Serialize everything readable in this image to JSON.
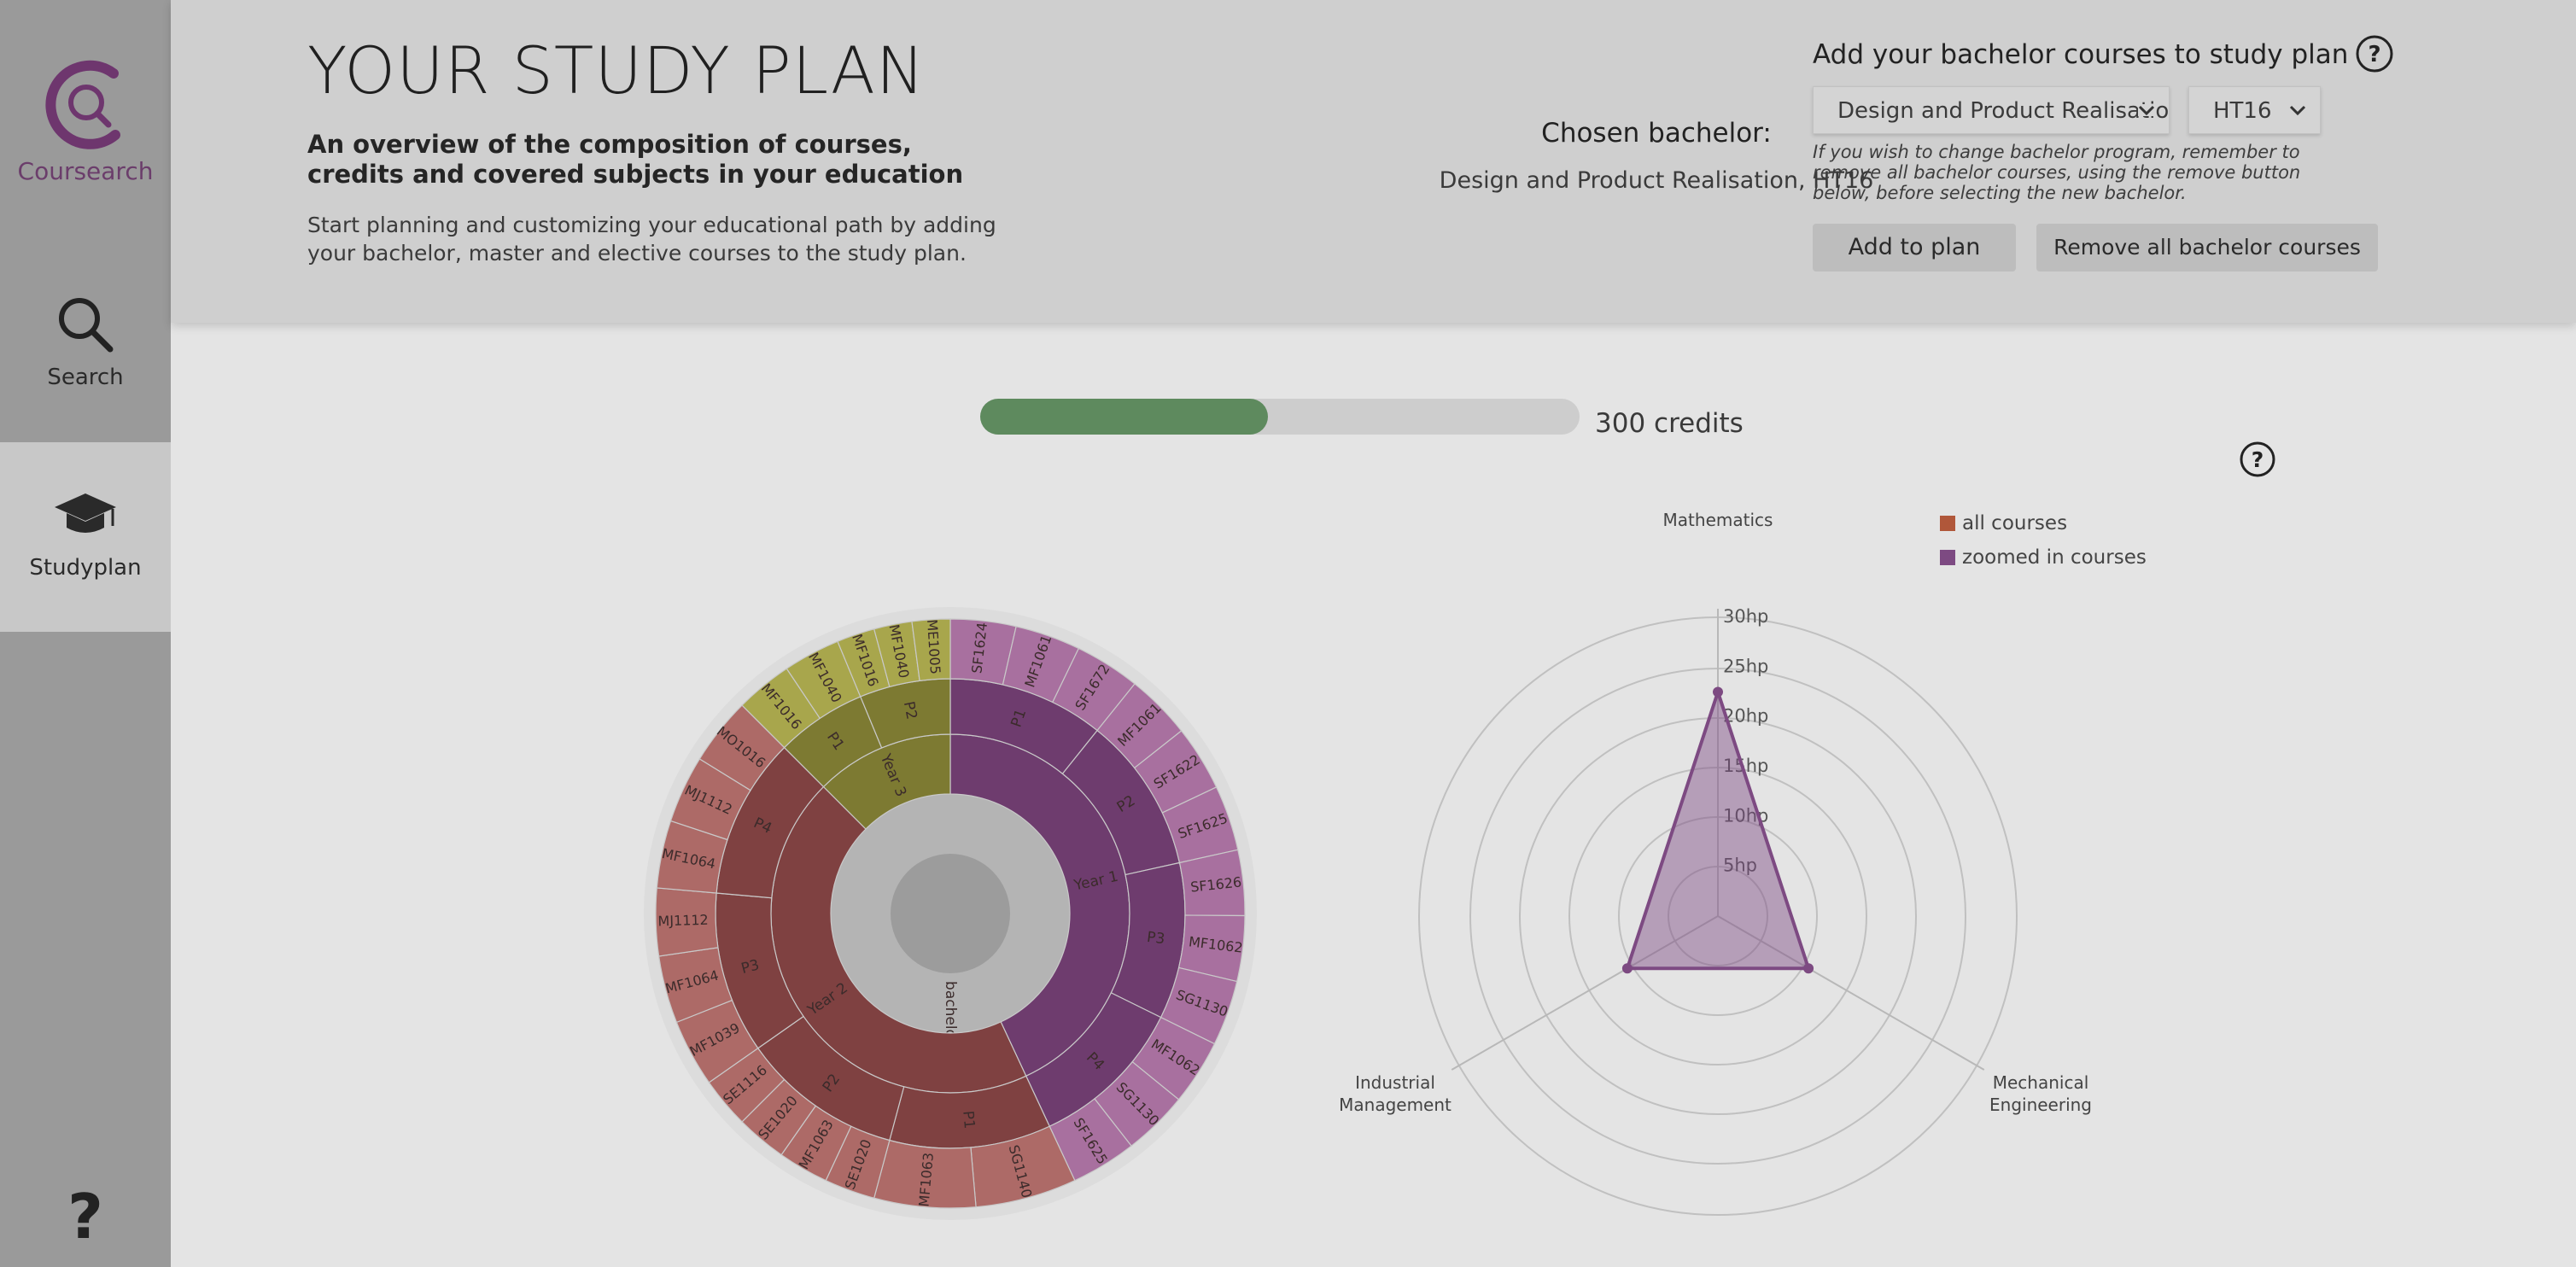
{
  "sidebar": {
    "logo_label": "Coursearch",
    "items": [
      {
        "label": "Search",
        "icon": "search-icon"
      },
      {
        "label": "Studyplan",
        "icon": "graduation-cap-icon",
        "active": true
      }
    ],
    "help_icon": "question-icon"
  },
  "header": {
    "title": "YOUR STUDY PLAN",
    "subtitle": "An overview of the composition of courses, credits and covered subjects in your education",
    "description": "Start planning and customizing your educational path by adding your bachelor, master and elective courses to the study plan.",
    "chosen_label": "Chosen bachelor:",
    "chosen_value": "Design and Product Realisation, HT16",
    "add_title": "Add your bachelor courses to study plan",
    "program_select": "Design and Product Realisation",
    "term_select": "HT16",
    "note": "If you wish to change bachelor program, remember to remove all bachelor courses, using the remove button below, before selecting the new bachelor.",
    "add_button": "Add to plan",
    "remove_button": "Remove all bachelor courses"
  },
  "progress": {
    "fraction": 0.48,
    "label": "300 credits",
    "color": "#5e8a5e"
  },
  "sunburst": {
    "center": "",
    "root": "bachelor",
    "years": [
      {
        "label": "Year 1",
        "color": "#6e3c6e",
        "periods": [
          {
            "label": "P1",
            "courses": [
              "SF1624",
              "MF1061",
              "SF1672"
            ]
          },
          {
            "label": "P2",
            "courses": [
              "MF1061",
              "SF1622",
              "SF1625"
            ]
          },
          {
            "label": "P3",
            "courses": [
              "SF1626",
              "MF1062",
              "SG1130"
            ]
          },
          {
            "label": "P4",
            "courses": [
              "MF1062",
              "SG1130",
              "SF1625"
            ]
          }
        ]
      },
      {
        "label": "Year 2",
        "color": "#7f4141",
        "periods": [
          {
            "label": "P1",
            "courses": [
              "SG1140",
              "MF1063"
            ]
          },
          {
            "label": "P2",
            "courses": [
              "SE1020",
              "MF1063",
              "SE1020",
              "SE1116"
            ]
          },
          {
            "label": "P3",
            "courses": [
              "MF1039",
              "MF1064",
              "MJ1112"
            ]
          },
          {
            "label": "P4",
            "courses": [
              "MF1064",
              "MJ1112",
              "MO1016"
            ]
          }
        ]
      },
      {
        "label": "Year 3",
        "color": "#7d7a32",
        "periods": [
          {
            "label": "P1",
            "courses": [
              "MF1016",
              "MF1040"
            ]
          },
          {
            "label": "P2",
            "courses": [
              "MF1016",
              "MF1040",
              "ME1005"
            ]
          }
        ]
      }
    ]
  },
  "radar": {
    "ticks": [
      "5hp",
      "10hp",
      "15hp",
      "20hp",
      "25hp",
      "30hp"
    ],
    "axes": [
      "Mathematics",
      "Mechanical Engineering",
      "Industrial Management"
    ],
    "legend": [
      {
        "label": "all courses",
        "color": "#b0573a"
      },
      {
        "label": "zoomed in courses",
        "color": "#7d4a82"
      }
    ]
  },
  "chart_data": [
    {
      "type": "radar",
      "axes": [
        "Mathematics",
        "Mechanical Engineering",
        "Industrial Management"
      ],
      "ticks": [
        "5hp",
        "10hp",
        "15hp",
        "20hp",
        "25hp",
        "30hp"
      ],
      "ylim": [
        0,
        30
      ],
      "series": [
        {
          "name": "zoomed in courses",
          "values": [
            22.5,
            10.5,
            10.5
          ]
        }
      ]
    }
  ],
  "main_help_icon": "question-icon"
}
